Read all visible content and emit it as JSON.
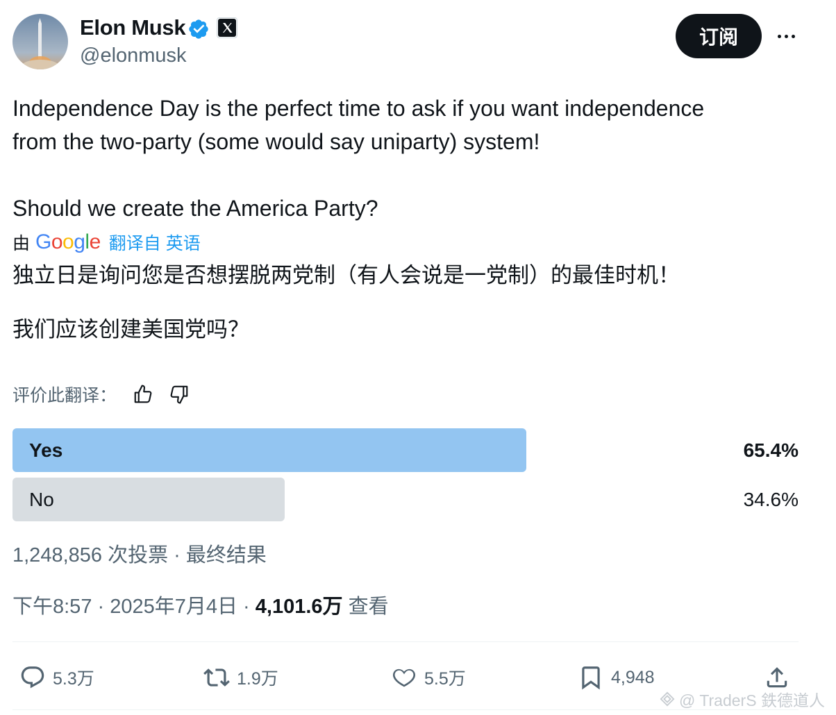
{
  "author": {
    "name": "Elon Musk",
    "handle": "@elonmusk",
    "avatar_icon": "rocket-launch-avatar",
    "verified_icon": "verified-badge-icon",
    "affiliation_icon": "x-logo-icon"
  },
  "header": {
    "subscribe_label": "订阅",
    "more_icon": "more-dots-icon"
  },
  "tweet": {
    "lines": [
      "Independence Day is the perfect time to ask if you want independence",
      "from the two-party (some would say uniparty) system!",
      "Should we create the America Party?"
    ]
  },
  "translation": {
    "by_label": "由",
    "provider": "Google",
    "from_label": "翻译自 英语",
    "lines": [
      "独立日是询问您是否想摆脱两党制（有人会说是一党制）的最佳时机！",
      "我们应该创建美国党吗？"
    ],
    "rate_label": "评价此翻译：",
    "thumb_up_icon": "thumbs-up-icon",
    "thumb_down_icon": "thumbs-down-icon"
  },
  "poll": {
    "options": [
      {
        "label": "Yes",
        "percent_text": "65.4%",
        "percent": 65.4,
        "winner": true,
        "color": "#93c5f1"
      },
      {
        "label": "No",
        "percent_text": "34.6%",
        "percent": 34.6,
        "winner": false,
        "color": "#d8dde1"
      }
    ],
    "votes_text": "1,248,856 次投票 · 最终结果"
  },
  "meta": {
    "time": "下午8:57 · 2025年7月4日 · ",
    "views_count": "4,101.6万",
    "views_label": " 查看"
  },
  "actions": {
    "replies": "5.3万",
    "reposts": "1.9万",
    "likes": "5.5万",
    "bookmarks": "4,948"
  },
  "watermark": "@ TraderS 鉄德道人",
  "colors": {
    "text": "#0f1419",
    "secondary": "#536471",
    "link": "#1d9bf0",
    "verified": "#1d9bf0"
  }
}
